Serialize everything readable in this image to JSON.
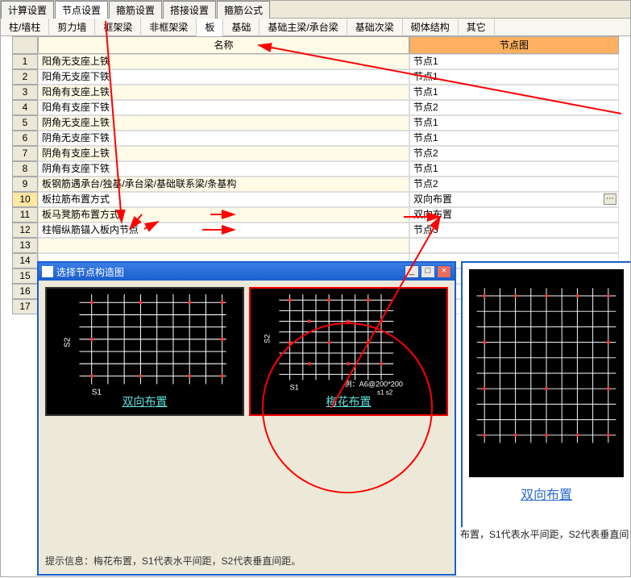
{
  "top_tabs": {
    "items": [
      "计算设置",
      "节点设置",
      "箍筋设置",
      "搭接设置",
      "箍筋公式"
    ],
    "active_index": 1
  },
  "category_tabs": {
    "items": [
      "柱/墙柱",
      "剪力墙",
      "框架梁",
      "非框架梁",
      "板",
      "基础",
      "基础主梁/承台梁",
      "基础次梁",
      "砌体结构",
      "其它"
    ],
    "active_index": 4
  },
  "grid": {
    "headers": {
      "index": "",
      "name": "名称",
      "value": "节点图"
    },
    "rows": [
      {
        "idx": "1",
        "name": "阳角无支座上铁",
        "value": "节点1"
      },
      {
        "idx": "2",
        "name": "阳角无支座下铁",
        "value": "节点1"
      },
      {
        "idx": "3",
        "name": "阳角有支座上铁",
        "value": "节点1"
      },
      {
        "idx": "4",
        "name": "阳角有支座下铁",
        "value": "节点2"
      },
      {
        "idx": "5",
        "name": "阴角无支座上铁",
        "value": "节点1"
      },
      {
        "idx": "6",
        "name": "阴角无支座下铁",
        "value": "节点1"
      },
      {
        "idx": "7",
        "name": "阴角有支座上铁",
        "value": "节点2"
      },
      {
        "idx": "8",
        "name": "阴角有支座下铁",
        "value": "节点1"
      },
      {
        "idx": "9",
        "name": "板钢筋遇承台/独基/承台梁/基础联系梁/条基构",
        "value": "节点2"
      },
      {
        "idx": "10",
        "name": "板拉筋布置方式",
        "value": "双向布置",
        "has_btn": true,
        "selected": true
      },
      {
        "idx": "11",
        "name": "板马凳筋布置方式",
        "value": "双向布置"
      },
      {
        "idx": "12",
        "name": "柱帽纵筋锚入板内节点",
        "value": "节点3"
      },
      {
        "idx": "13",
        "name": "",
        "value": ""
      },
      {
        "idx": "14",
        "name": "",
        "value": ""
      },
      {
        "idx": "15",
        "name": "",
        "value": ""
      },
      {
        "idx": "16",
        "name": "",
        "value": ""
      },
      {
        "idx": "17",
        "name": "",
        "value": ""
      }
    ]
  },
  "dialog": {
    "title": "选择节点构造图",
    "choices": [
      {
        "caption": "双向布置",
        "axis_s1": "S1",
        "axis_s2": "S2"
      },
      {
        "caption": "梅花布置",
        "axis_s1": "S1",
        "axis_s2": "S2",
        "example": "例：A6@200*200",
        "example_sub": "s1   s2",
        "selected": true
      }
    ],
    "footer_hint": "提示信息：梅花布置，S1代表水平间距，S2代表垂直间距。",
    "window_buttons": {
      "min": "_",
      "max": "□",
      "close": "×"
    }
  },
  "right_preview": {
    "caption": "双向布置",
    "bottom_hint": "布置，S1代表水平间距，S2代表垂直间"
  },
  "ellipsis_label": "⋯"
}
